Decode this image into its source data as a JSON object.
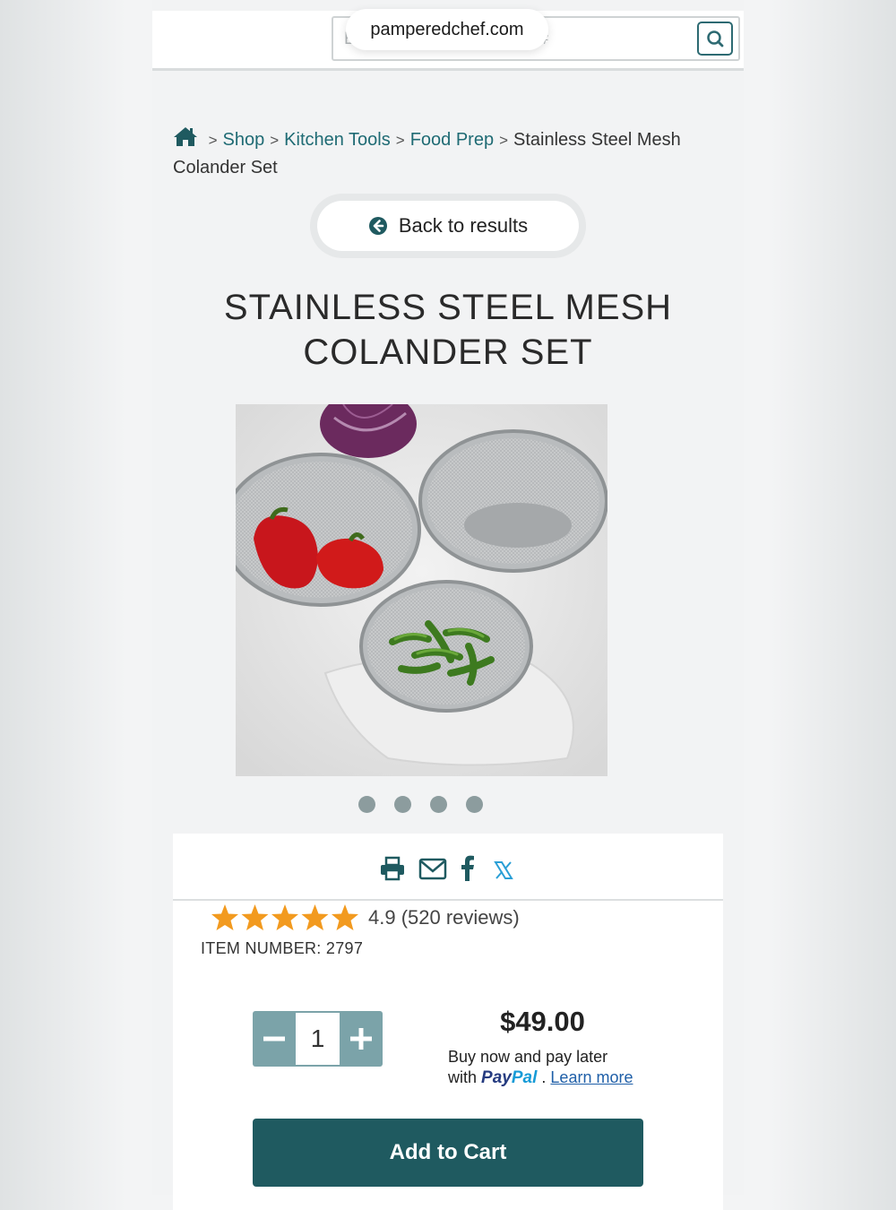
{
  "browser": {
    "url": "pamperedchef.com"
  },
  "search": {
    "placeholder": "Enter keyword or product #"
  },
  "breadcrumb": {
    "items": [
      "Shop",
      "Kitchen Tools",
      "Food Prep"
    ],
    "current": "Stainless Steel Mesh Colander Set",
    "separator": ">"
  },
  "back_button": {
    "label": "Back to results"
  },
  "product": {
    "title_line1": "STAINLESS STEEL MESH",
    "title_line2": "COLANDER SET",
    "image_dots": 4,
    "rating": 4.9,
    "rating_text": "4.9 (520 reviews)",
    "item_number": "ITEM NUMBER: 2797",
    "quantity": "1",
    "price": "$49.00",
    "paypal_line1": "Buy now and pay later",
    "paypal_with": "with",
    "paypal_pay": "Pay",
    "paypal_pal": "Pal",
    "paypal_dot": ".",
    "learn_more": "Learn more",
    "add_to_cart": "Add to Cart"
  },
  "colors": {
    "accent": "#1f5a60",
    "link": "#1f6b74",
    "star": "#f29a1f",
    "qty_button": "#7ba3a9"
  },
  "icons": [
    "home-icon",
    "search-icon",
    "arrow-left-circle-icon",
    "print-icon",
    "email-icon",
    "facebook-icon",
    "x-icon",
    "star-icon",
    "minus-icon",
    "plus-icon"
  ]
}
